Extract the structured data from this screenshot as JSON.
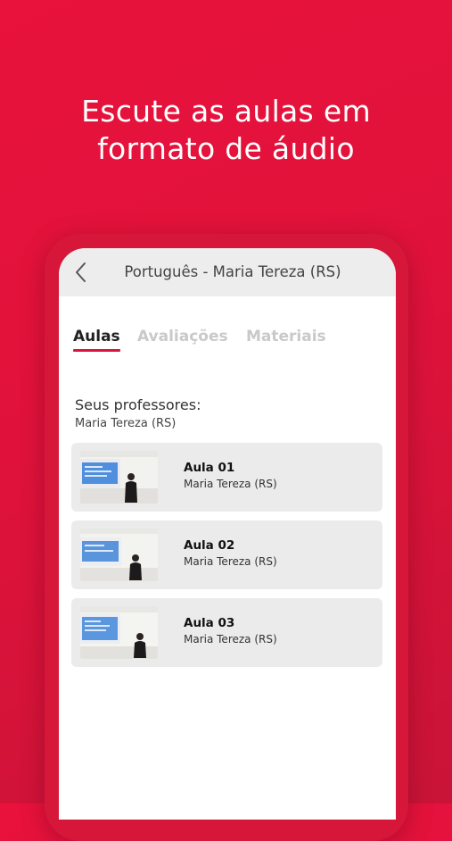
{
  "promo": {
    "line1": "Escute as aulas em",
    "line2": "formato de áudio"
  },
  "header": {
    "back_icon": "chevron-left-icon",
    "title": "Português - Maria Tereza (RS)"
  },
  "tabs": [
    {
      "label": "Aulas",
      "active": true
    },
    {
      "label": "Avaliações",
      "active": false
    },
    {
      "label": "Materiais",
      "active": false
    }
  ],
  "teachers": {
    "heading": "Seus professores:",
    "name": "Maria Tereza (RS)"
  },
  "lessons": [
    {
      "title": "Aula 01",
      "teacher": "Maria Tereza (RS)"
    },
    {
      "title": "Aula 02",
      "teacher": "Maria Tereza (RS)"
    },
    {
      "title": "Aula 03",
      "teacher": "Maria Tereza (RS)"
    }
  ],
  "colors": {
    "brand_red": "#e8123c",
    "active_tab_underline": "#d9163a",
    "inactive_tab_text": "#c9c9c9"
  }
}
